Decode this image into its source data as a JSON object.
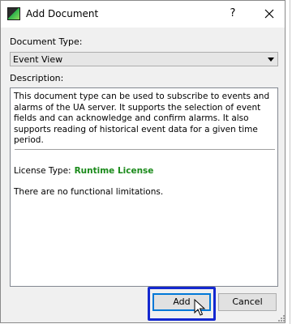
{
  "window": {
    "title": "Add Document",
    "help_label": "?"
  },
  "form": {
    "doc_type_label": "Document Type:",
    "doc_type_value": "Event View",
    "description_label": "Description:",
    "description_text": "This document type can be used to subscribe to events and alarms of the UA server. It supports the selection of event fields and can acknowledge and confirm alarms. It also supports reading of historical event data for a given time period.",
    "license_label": "License Type:",
    "license_value": "Runtime License",
    "limitations_text": "There are no functional limitations."
  },
  "buttons": {
    "add_label": "Add",
    "cancel_label": "Cancel"
  },
  "colors": {
    "license_value": "#1a8a1a",
    "focus_highlight": "#1428d0",
    "default_button_border": "#0078d7"
  },
  "icons": [
    "app-icon",
    "help-icon",
    "close-icon",
    "dropdown-arrow-icon",
    "mouse-cursor-icon",
    "resize-grip-icon"
  ]
}
